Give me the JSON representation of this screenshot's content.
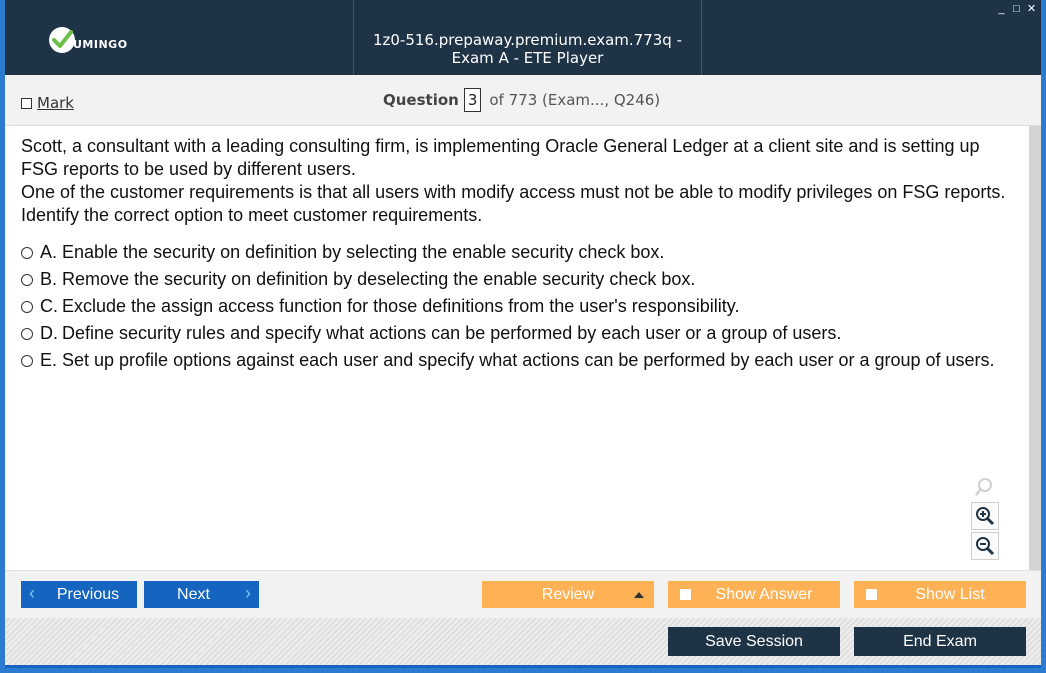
{
  "window": {
    "title": "1z0-516.prepaway.premium.exam.773q - Exam A - ETE Player",
    "logo_text": "UMINGO",
    "controls": {
      "minimize": "_",
      "maximize": "□",
      "close": "✕"
    }
  },
  "question_header": {
    "mark_label": "Mark",
    "question_label": "Question",
    "question_number": "3",
    "question_of": "of 773 (Exam..., Q246)"
  },
  "question": {
    "stem": [
      "Scott, a consultant with a leading consulting firm, is implementing Oracle General Ledger at a client site and is setting up FSG reports to be used by different users.",
      "One of the customer requirements is that all users with modify access must not be able to modify privileges on FSG reports. Identify the correct option to meet customer requirements."
    ],
    "options": [
      {
        "letter": "A.",
        "text": "Enable the security on definition by selecting the enable security check box."
      },
      {
        "letter": "B.",
        "text": "Remove the security on definition by deselecting the enable security check box."
      },
      {
        "letter": "C.",
        "text": "Exclude the assign access function for those definitions from the user's responsibility."
      },
      {
        "letter": "D.",
        "text": "Define security rules and specify what actions can be performed by each user or a group of users."
      },
      {
        "letter": "E.",
        "text": "Set up profile options against each user and specify what actions can be performed by each user or a group of users."
      }
    ]
  },
  "nav": {
    "previous_label": "Previous",
    "next_label": "Next",
    "review_label": "Review",
    "show_answer_label": "Show Answer",
    "show_list_label": "Show List"
  },
  "footer": {
    "save_session_label": "Save Session",
    "end_exam_label": "End Exam"
  },
  "icons": {
    "logo": "check-circle-icon",
    "search": "search-icon",
    "zoom_in": "zoom-in-icon",
    "zoom_out": "zoom-out-icon",
    "prev": "chevron-left-icon",
    "next": "chevron-right-icon",
    "review_dropdown": "triangle-up-icon"
  },
  "colors": {
    "title_bar": "#1f3347",
    "accent_blue": "#1565c0",
    "orange": "#ffb155",
    "logo_green": "#6cc04a"
  }
}
